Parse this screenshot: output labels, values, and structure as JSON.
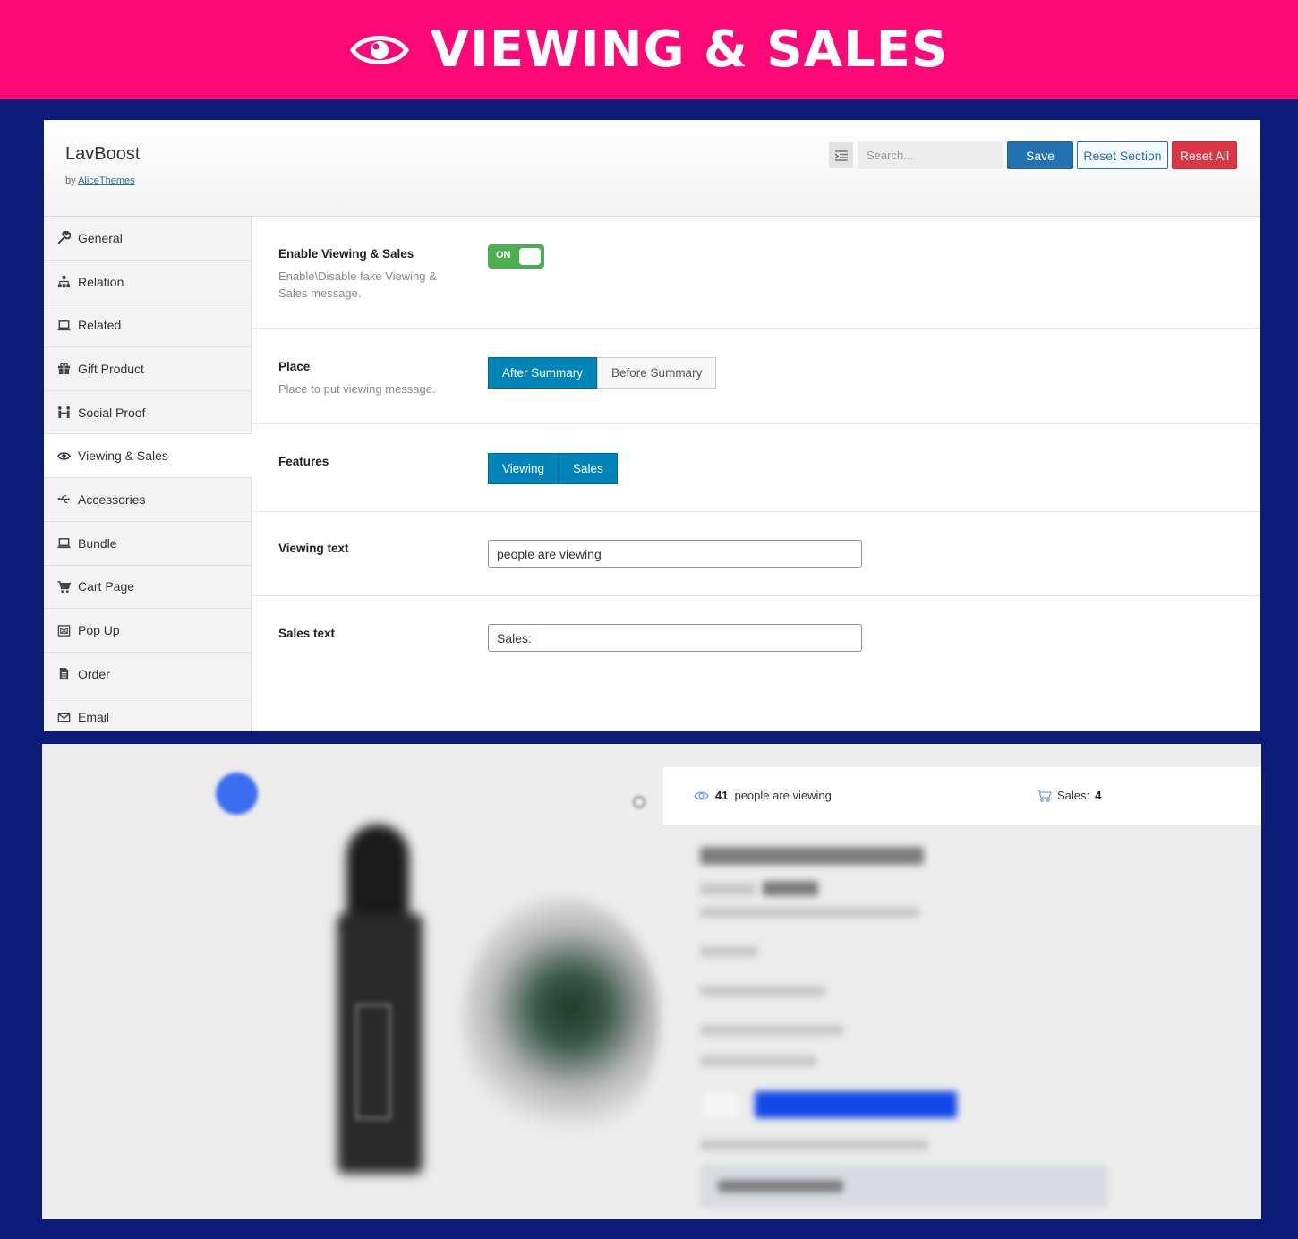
{
  "banner": {
    "title": "VIEWING & SALES",
    "icon": "eye-icon"
  },
  "header": {
    "brand": "LavBoost",
    "by": "by",
    "author": "AliceThemes",
    "search_placeholder": "Search...",
    "save_label": "Save",
    "reset_section_label": "Reset Section",
    "reset_all_label": "Reset All"
  },
  "sidebar": {
    "active_index": 5,
    "items": [
      {
        "label": "General",
        "icon": "wrench-icon"
      },
      {
        "label": "Relation",
        "icon": "sitemap-icon"
      },
      {
        "label": "Related",
        "icon": "laptop-icon"
      },
      {
        "label": "Gift Product",
        "icon": "gift-icon"
      },
      {
        "label": "Social Proof",
        "icon": "people-icon"
      },
      {
        "label": "Viewing & Sales",
        "icon": "eye-icon"
      },
      {
        "label": "Accessories",
        "icon": "usb-icon"
      },
      {
        "label": "Bundle",
        "icon": "laptop-icon"
      },
      {
        "label": "Cart Page",
        "icon": "cart-icon"
      },
      {
        "label": "Pop Up",
        "icon": "popup-icon"
      },
      {
        "label": "Order",
        "icon": "document-icon"
      },
      {
        "label": "Email",
        "icon": "envelope-icon"
      }
    ]
  },
  "settings": {
    "enable": {
      "title": "Enable Viewing & Sales",
      "desc": "Enable\\Disable fake Viewing & Sales message.",
      "toggle_label": "ON",
      "value": true
    },
    "place": {
      "title": "Place",
      "desc": "Place to put viewing message.",
      "options": [
        "After Summary",
        "Before Summary"
      ],
      "selected": "After Summary"
    },
    "features": {
      "title": "Features",
      "options": [
        "Viewing",
        "Sales"
      ],
      "selected": [
        "Viewing",
        "Sales"
      ]
    },
    "viewing_text": {
      "title": "Viewing text",
      "value": "people are viewing"
    },
    "sales_text": {
      "title": "Sales text",
      "value": "Sales:"
    }
  },
  "preview": {
    "viewers": "41",
    "viewing_text": "people are viewing",
    "sales_label": "Sales:",
    "sales_count": "4"
  },
  "colors": {
    "banner": "#fc0977",
    "background": "#0c1a78",
    "primary": "#2271b1",
    "danger": "#dc3545",
    "toggle_on": "#4caf50",
    "segment_active": "#0085ba"
  }
}
